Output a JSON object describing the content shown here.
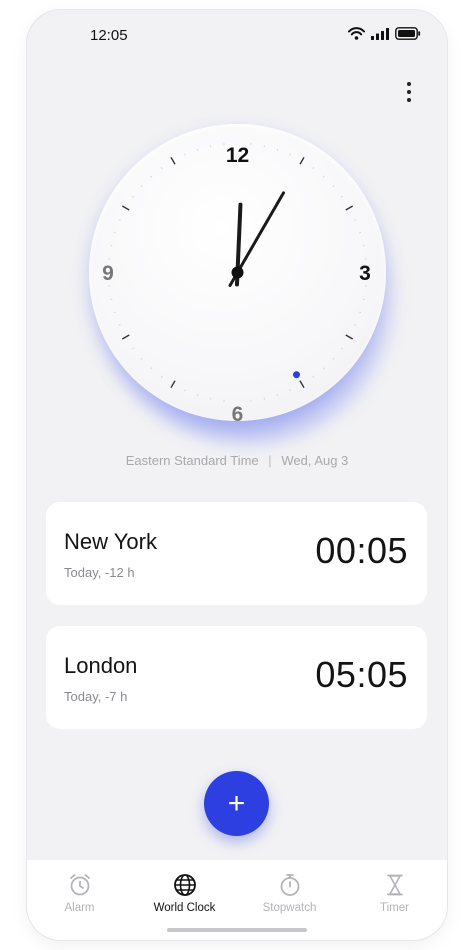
{
  "status_bar": {
    "time": "12:05",
    "icons": [
      "wifi-icon",
      "cellular-signal-icon",
      "battery-icon"
    ]
  },
  "header": {
    "more_icon": "more-vertical-icon"
  },
  "clock": {
    "numerals": [
      "12",
      "3",
      "6",
      "9"
    ],
    "hour": 0,
    "minute": 5,
    "second": 25,
    "hand_color": "#1a1a1a",
    "second_dot_color": "#2d3fe0"
  },
  "timezone": {
    "name": "Eastern Standard Time",
    "separator": "|",
    "date": "Wed, Aug 3"
  },
  "cities": [
    {
      "name": "New York",
      "offset": "Today,  -12 h",
      "time": "00:05"
    },
    {
      "name": "London",
      "offset": "Today,  -7 h",
      "time": "05:05"
    }
  ],
  "fab": {
    "label": "+"
  },
  "tabs": [
    {
      "label": "Alarm",
      "icon": "alarm-clock-icon",
      "active": false
    },
    {
      "label": "World Clock",
      "icon": "globe-icon",
      "active": true
    },
    {
      "label": "Stopwatch",
      "icon": "stopwatch-icon",
      "active": false
    },
    {
      "label": "Timer",
      "icon": "hourglass-icon",
      "active": false
    }
  ],
  "colors": {
    "accent": "#2d3fe0",
    "background": "#f2f2f4",
    "card": "#ffffff",
    "muted_text": "#a8a8ae"
  }
}
